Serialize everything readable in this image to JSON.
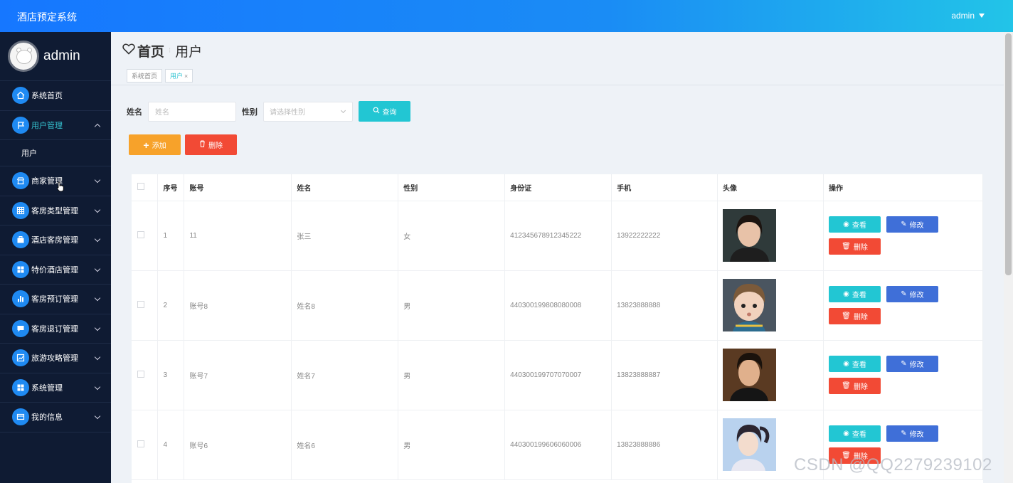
{
  "header": {
    "app_title": "酒店预定系统",
    "user": "admin"
  },
  "sidebar": {
    "profile_name": "admin",
    "items": [
      {
        "label": "系统首页",
        "icon": "home-icon"
      },
      {
        "label": "用户管理",
        "icon": "flag-icon",
        "expanded": true,
        "sub": [
          "用户"
        ]
      },
      {
        "label": "商家管理",
        "icon": "store-icon"
      },
      {
        "label": "客房类型管理",
        "icon": "grid-icon"
      },
      {
        "label": "酒店客房管理",
        "icon": "briefcase-icon"
      },
      {
        "label": "特价酒店管理",
        "icon": "apps-icon"
      },
      {
        "label": "客房预订管理",
        "icon": "bar-chart-icon"
      },
      {
        "label": "客房退订管理",
        "icon": "message-icon"
      },
      {
        "label": "旅游攻略管理",
        "icon": "chart-icon"
      },
      {
        "label": "系统管理",
        "icon": "apps-icon"
      },
      {
        "label": "我的信息",
        "icon": "card-icon"
      }
    ]
  },
  "breadcrumb": {
    "home": "首页",
    "page": "用户"
  },
  "tags": [
    {
      "label": "系统首页"
    },
    {
      "label": "用户"
    }
  ],
  "search": {
    "name_label": "姓名",
    "name_placeholder": "姓名",
    "gender_label": "性别",
    "gender_placeholder": "请选择性别",
    "query_button": "查询"
  },
  "actions": {
    "add": "添加",
    "delete": "删除"
  },
  "table": {
    "headers": [
      "序号",
      "账号",
      "姓名",
      "性别",
      "身份证",
      "手机",
      "头像",
      "操作"
    ],
    "rows": [
      {
        "no": "1",
        "account": "11",
        "name": "张三",
        "gender": "女",
        "id_card": "412345678912345222",
        "phone": "13922222222"
      },
      {
        "no": "2",
        "account": "账号8",
        "name": "姓名8",
        "gender": "男",
        "id_card": "440300199808080008",
        "phone": "13823888888"
      },
      {
        "no": "3",
        "account": "账号7",
        "name": "姓名7",
        "gender": "男",
        "id_card": "440300199707070007",
        "phone": "13823888887"
      },
      {
        "no": "4",
        "account": "账号6",
        "name": "姓名6",
        "gender": "男",
        "id_card": "440300199606060006",
        "phone": "13823888886"
      }
    ],
    "op_view": "查看",
    "op_edit": "修改",
    "op_delete": "删除"
  },
  "watermark": "CSDN @QQ2279239102",
  "colors": {
    "accent": "#22c6d3",
    "header_start": "#1677ff",
    "sidebar": "#0f1b33",
    "add": "#f7a22a",
    "danger": "#f24a35",
    "edit": "#3f6fd8"
  }
}
